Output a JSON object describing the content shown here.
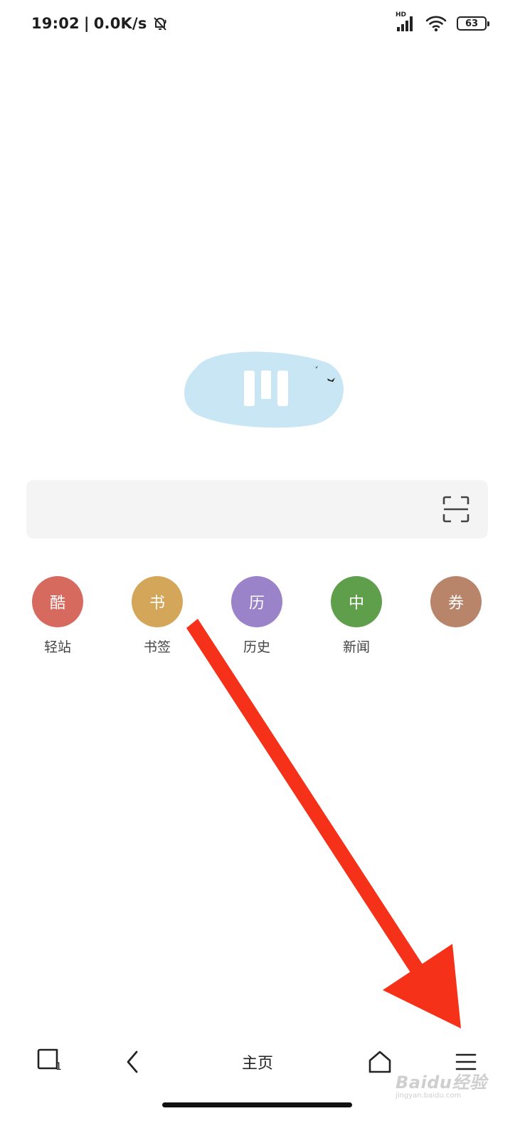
{
  "status_bar": {
    "time": "19:02",
    "separator": "|",
    "net_speed": "0.0K/s",
    "network_type": "HD",
    "battery": "63",
    "icons": [
      "mute-bell-icon",
      "signal-icon",
      "wifi-icon",
      "battery-icon"
    ]
  },
  "logo": {
    "icon": "browser-logo-icon",
    "colors": {
      "cloud": "#c8e6f4",
      "bars": "#ffffff",
      "birds": "#222222"
    }
  },
  "search": {
    "value": "",
    "placeholder": "",
    "scan_icon": "scan-icon"
  },
  "shortcuts": [
    {
      "glyph": "酷",
      "label": "轻站",
      "color": "#d66a5e"
    },
    {
      "glyph": "书",
      "label": "书签",
      "color": "#d4a659"
    },
    {
      "glyph": "历",
      "label": "历史",
      "color": "#9a83c9"
    },
    {
      "glyph": "中",
      "label": "新闻",
      "color": "#5f9f4c"
    },
    {
      "glyph": "券",
      "label": "",
      "color": "#b8856a"
    }
  ],
  "bottom_bar": {
    "tabs_count": "1",
    "home_label": "主页",
    "icons": [
      "tabs-icon",
      "back-icon",
      "home-icon",
      "menu-icon"
    ]
  },
  "annotation": {
    "color": "#f5311a",
    "icon": "red-arrow-icon"
  },
  "watermark": {
    "brand": "Baidu经验",
    "sub": "jingyan.baidu.com"
  }
}
